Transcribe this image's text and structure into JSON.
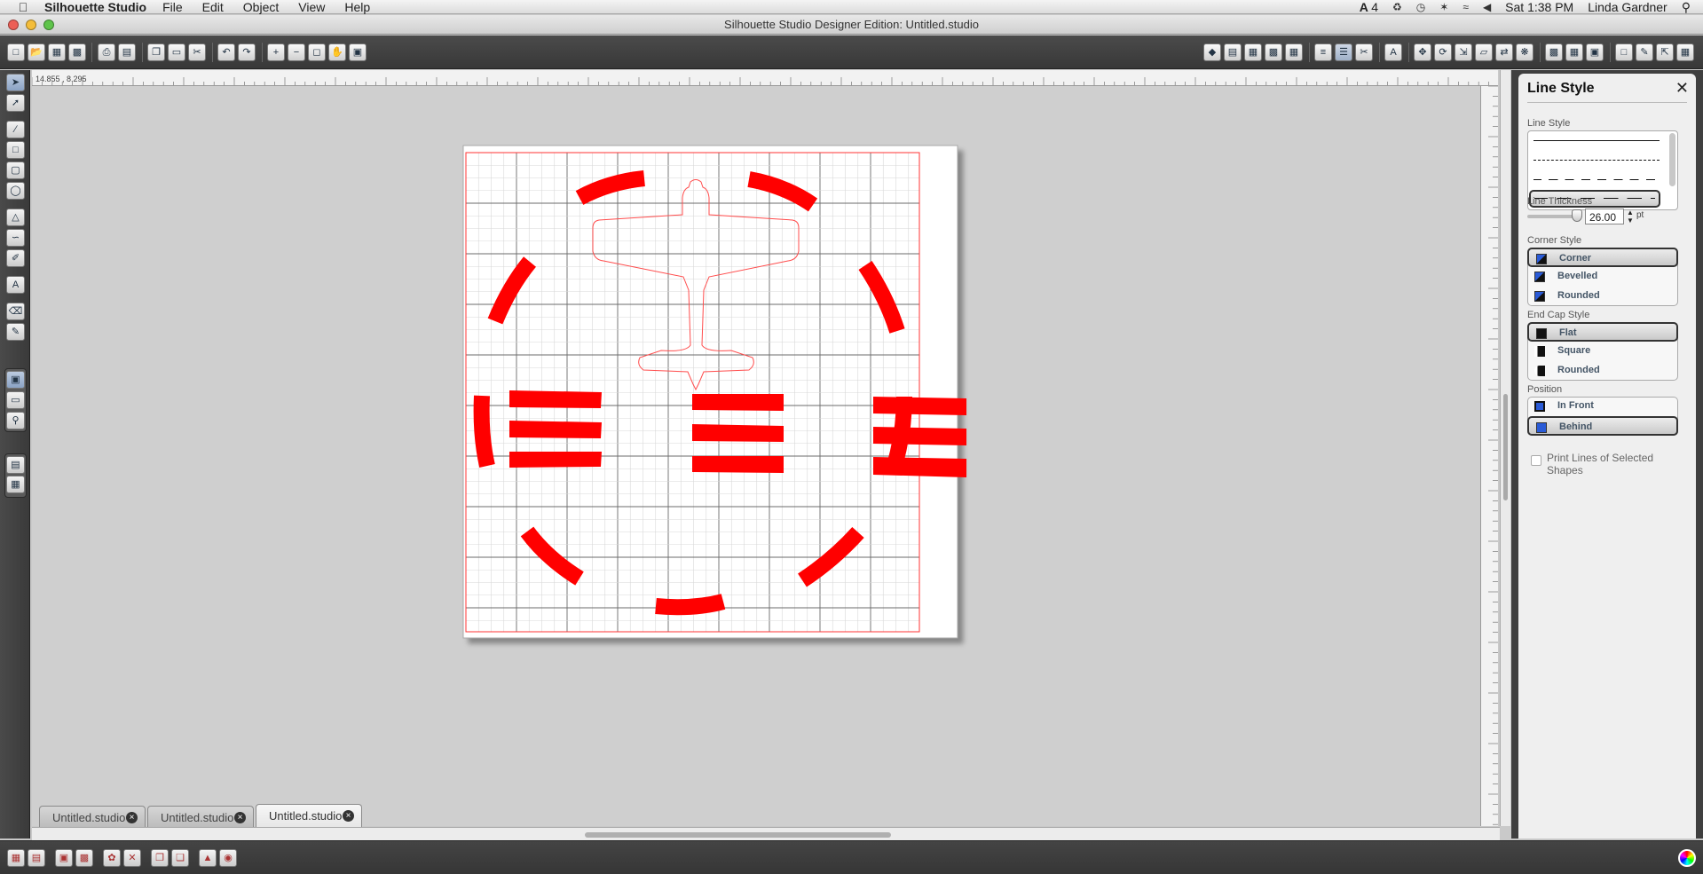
{
  "menubar": {
    "app_name": "Silhouette Studio",
    "menus": [
      "File",
      "Edit",
      "Object",
      "View",
      "Help"
    ],
    "status": {
      "badge_count": "4",
      "time": "Sat 1:38 PM",
      "user": "Linda Gardner"
    }
  },
  "window": {
    "title": "Silhouette Studio Designer Edition: Untitled.studio"
  },
  "ruler": {
    "coords": "14.855 , 8.295"
  },
  "tabs": [
    {
      "label": "Untitled.studio"
    },
    {
      "label": "Untitled.studio"
    },
    {
      "label": "Untitled.studio"
    }
  ],
  "panel": {
    "title": "Line Style",
    "line_style_label": "Line Style",
    "line_thickness_label": "Line Thickness",
    "line_thickness_value": "26.00",
    "line_thickness_unit": "pt",
    "corner_style_label": "Corner Style",
    "corner_options": [
      "Corner",
      "Bevelled",
      "Rounded"
    ],
    "end_cap_label": "End Cap Style",
    "end_cap_options": [
      "Flat",
      "Square",
      "Rounded"
    ],
    "position_label": "Position",
    "position_options": [
      "In Front",
      "Behind"
    ],
    "print_lines_label": "Print Lines of Selected Shapes"
  },
  "colors": {
    "accent_red": "#ff0000",
    "selection_blue": "#2255cc"
  },
  "icons": {
    "apple": "apple-icon",
    "search": "spotlight-icon",
    "close": "close-icon",
    "wifi": "wifi-icon",
    "volume": "volume-icon",
    "bluetooth": "bluetooth-icon"
  }
}
